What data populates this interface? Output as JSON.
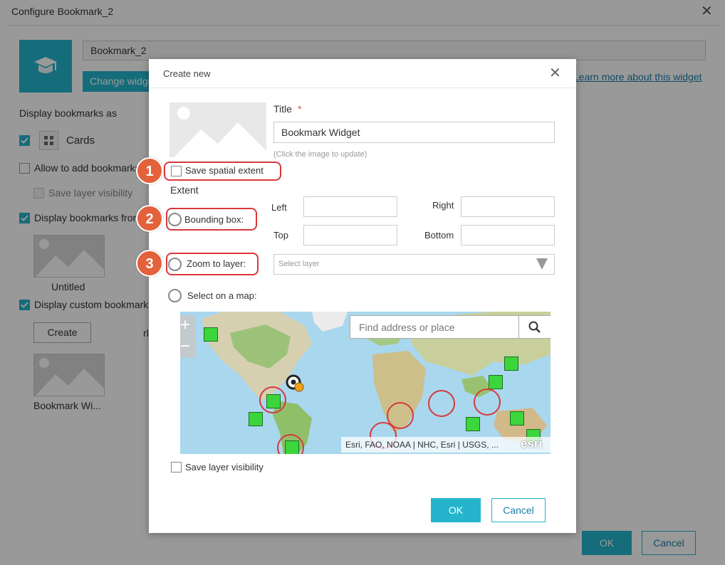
{
  "background": {
    "title": "Configure Bookmark_2",
    "widget_name": "Bookmark_2",
    "change_button": "Change widget",
    "learn_link": "Learn more about this widget",
    "display_as_label": "Display bookmarks as",
    "cards_label": "Cards",
    "allow_add_label": "Allow to add bookmarks",
    "save_layer_visibility": "Save layer visibility",
    "display_from_label": "Display bookmarks from",
    "untitled_label": "Untitled",
    "display_custom_label": "Display custom bookmarks",
    "create_button": "Create",
    "bookmark_caption": "Bookmark Wi...",
    "fragment_text": "rl",
    "ok_button": "OK",
    "cancel_button": "Cancel"
  },
  "modal": {
    "title": "Create new",
    "title_label": "Title",
    "required_mark": "*",
    "title_value": "Bookmark Widget",
    "image_hint": "(Click the image to update)",
    "save_spatial_extent": "Save spatial extent",
    "extent_label": "Extent",
    "bounding_box_label": "Bounding box:",
    "left_label": "Left",
    "right_label": "Right",
    "top_label": "Top",
    "bottom_label": "Bottom",
    "zoom_to_layer_label": "Zoom to layer:",
    "select_layer_placeholder": "Select layer",
    "select_on_map_label": "Select on a map:",
    "map": {
      "zoom_in": "+",
      "zoom_out": "−",
      "search_placeholder": "Find address or place",
      "attribution": "Esri, FAO, NOAA | NHC, Esri | USGS, ...",
      "logo": "esri"
    },
    "save_layer_visibility": "Save layer visibility",
    "ok_button": "OK",
    "cancel_button": "Cancel"
  },
  "callouts": [
    "1",
    "2",
    "3"
  ],
  "colors": {
    "accent": "#24b5cc",
    "callout_red": "#d9383a",
    "badge_orange": "#e3613b"
  }
}
